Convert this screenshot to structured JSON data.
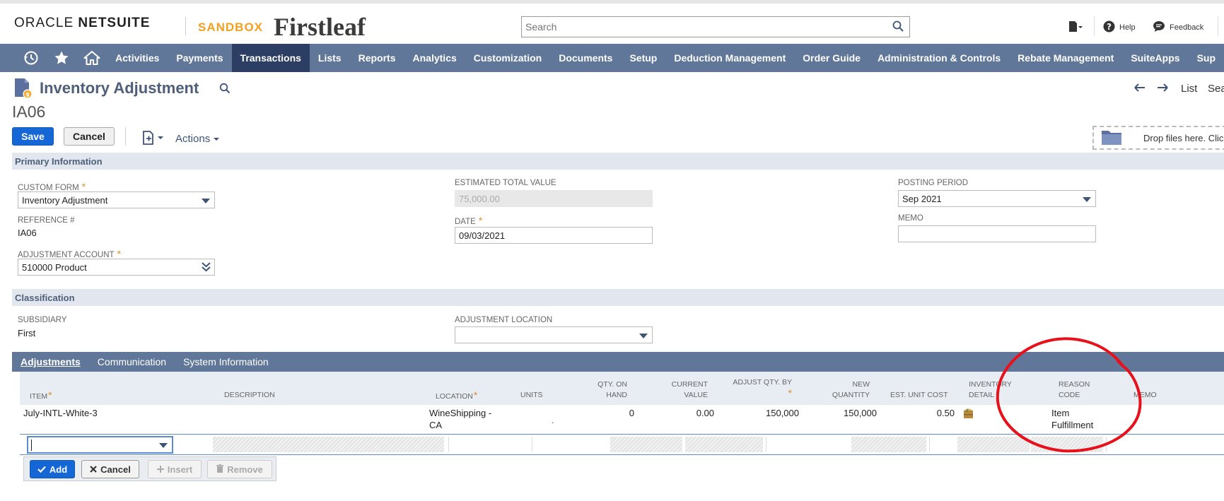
{
  "header": {
    "brand_oracle": "ORACLE",
    "brand_netsuite": "NETSUITE",
    "sandbox": "SANDBOX",
    "company_logo": "Firstleaf",
    "search_placeholder": "Search",
    "help": "Help",
    "feedback": "Feedback"
  },
  "nav": {
    "items": [
      "Activities",
      "Payments",
      "Transactions",
      "Lists",
      "Reports",
      "Analytics",
      "Customization",
      "Documents",
      "Setup",
      "Deduction Management",
      "Order Guide",
      "Administration & Controls",
      "Rebate Management",
      "SuiteApps",
      "Sup"
    ],
    "active": "Transactions"
  },
  "page": {
    "title": "Inventory Adjustment",
    "record_id": "IA06",
    "pager_list": "List",
    "pager_search": "Sea"
  },
  "toolbar": {
    "save": "Save",
    "cancel": "Cancel",
    "actions": "Actions",
    "dropzone": "Drop files here. Click"
  },
  "primary": {
    "section": "Primary Information",
    "custom_form_label": "CUSTOM FORM",
    "custom_form_value": "Inventory Adjustment",
    "reference_label": "REFERENCE #",
    "reference_value": "IA06",
    "adj_account_label": "ADJUSTMENT ACCOUNT",
    "adj_account_value": "510000 Product",
    "est_total_label": "ESTIMATED TOTAL VALUE",
    "est_total_value": "75,000.00",
    "date_label": "DATE",
    "date_value": "09/03/2021",
    "posting_period_label": "POSTING PERIOD",
    "posting_period_value": "Sep 2021",
    "memo_label": "MEMO",
    "memo_value": ""
  },
  "classification": {
    "section": "Classification",
    "subsidiary_label": "SUBSIDIARY",
    "subsidiary_value": "First",
    "adj_location_label": "ADJUSTMENT LOCATION",
    "adj_location_value": ""
  },
  "tabs": [
    "Adjustments",
    "Communication",
    "System Information"
  ],
  "grid": {
    "headers": {
      "item": "ITEM",
      "description": "DESCRIPTION",
      "location": "LOCATION",
      "units": "UNITS",
      "qty_on_hand_1": "QTY. ON",
      "qty_on_hand_2": "HAND",
      "current_value_1": "CURRENT",
      "current_value_2": "VALUE",
      "adjust_qty": "ADJUST QTY. BY",
      "new_qty_1": "NEW",
      "new_qty_2": "QUANTITY",
      "est_unit_cost": "EST. UNIT COST",
      "inv_detail_1": "INVENTORY",
      "inv_detail_2": "DETAIL",
      "reason_1": "REASON",
      "reason_2": "CODE",
      "memo": "MEMO"
    },
    "row": {
      "item": "July-INTL-White-3",
      "location_1": "WineShipping -",
      "location_2": "CA",
      "units": ".",
      "qty_on_hand": "0",
      "current_value": "0.00",
      "adjust_qty": "150,000",
      "new_qty": "150,000",
      "est_unit_cost": "0.50",
      "reason_1": "Item",
      "reason_2": "Fulfillment"
    }
  },
  "row_buttons": {
    "add": "Add",
    "cancel": "Cancel",
    "insert": "Insert",
    "remove": "Remove"
  },
  "colors": {
    "nav_bg": "#607799",
    "nav_active": "#2c3e63",
    "primary_button": "#1467d4",
    "section_bg": "#e1e6ef",
    "annotation": "#e8101a"
  }
}
